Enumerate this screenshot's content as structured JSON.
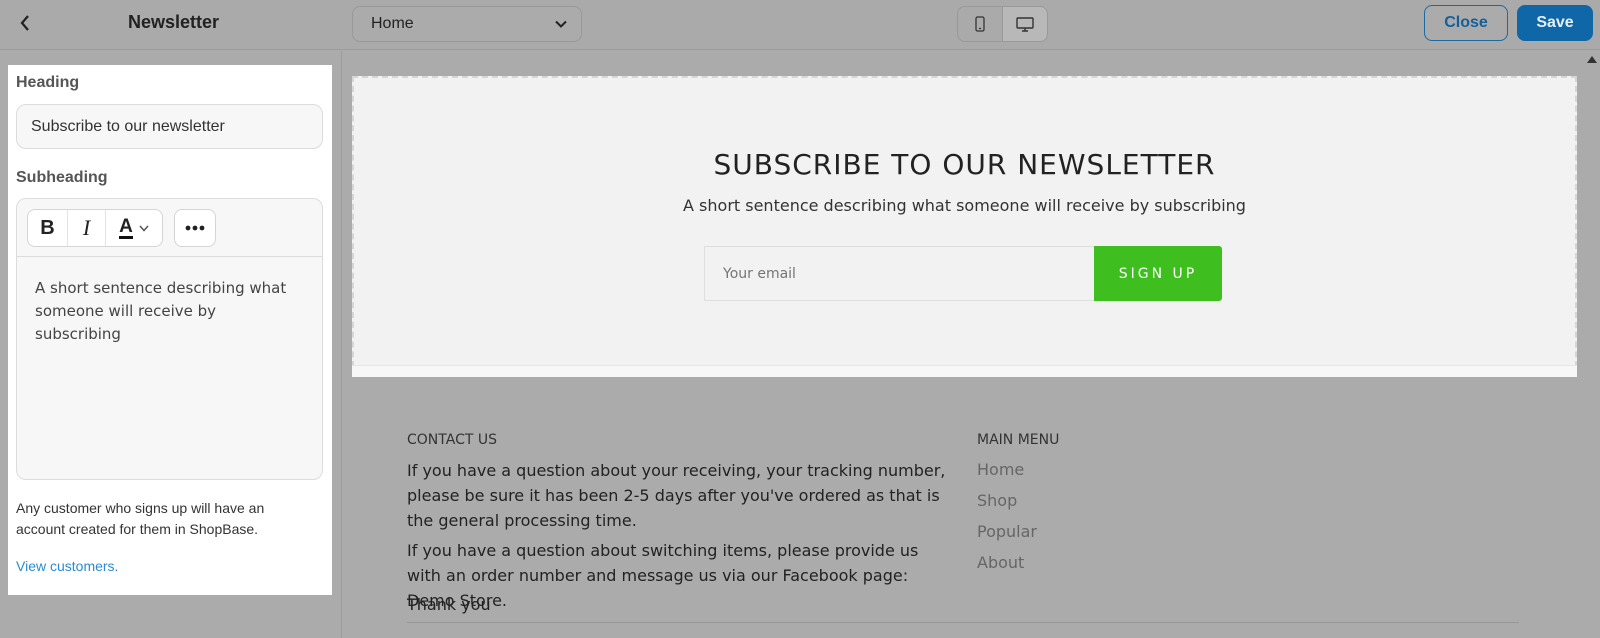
{
  "header": {
    "panel_title": "Newsletter",
    "page_select_value": "Home",
    "close_label": "Close",
    "save_label": "Save"
  },
  "sidebar": {
    "heading_label": "Heading",
    "heading_value": "Subscribe to our newsletter",
    "subheading_label": "Subheading",
    "subheading_value": "A short sentence describing what someone will receive by subscribing",
    "toolbar": {
      "bold": "B",
      "italic": "I",
      "color": "A"
    },
    "help_text": "Any customer who signs up will have an account created for them in ShopBase.",
    "help_link": "View customers."
  },
  "preview": {
    "newsletter": {
      "heading": "SUBSCRIBE TO OUR NEWSLETTER",
      "subheading": "A short sentence describing what someone will receive by subscribing",
      "email_placeholder": "Your email",
      "signup_label": "SIGN UP"
    },
    "footer": {
      "contact_heading": "CONTACT US",
      "contact_p1": "If you have a question about your receiving, your tracking number, please be sure it has been 2-5 days after you've ordered as that is the general processing time.",
      "contact_p2": "If you have a question about switching items, please provide us with an order number and message us via our Facebook page: Demo Store.",
      "contact_p3": "Thank you",
      "menu_heading": "MAIN MENU",
      "menu_items": [
        "Home",
        "Shop",
        "Popular",
        "About"
      ]
    }
  },
  "colors": {
    "accent": "#0f67a8",
    "signup": "#3fbf1f",
    "link": "#2a8bd4"
  },
  "icons": [
    "chevron-left-icon",
    "chevron-down-icon",
    "mobile-icon",
    "desktop-icon",
    "more-icon",
    "scroll-up-icon"
  ]
}
